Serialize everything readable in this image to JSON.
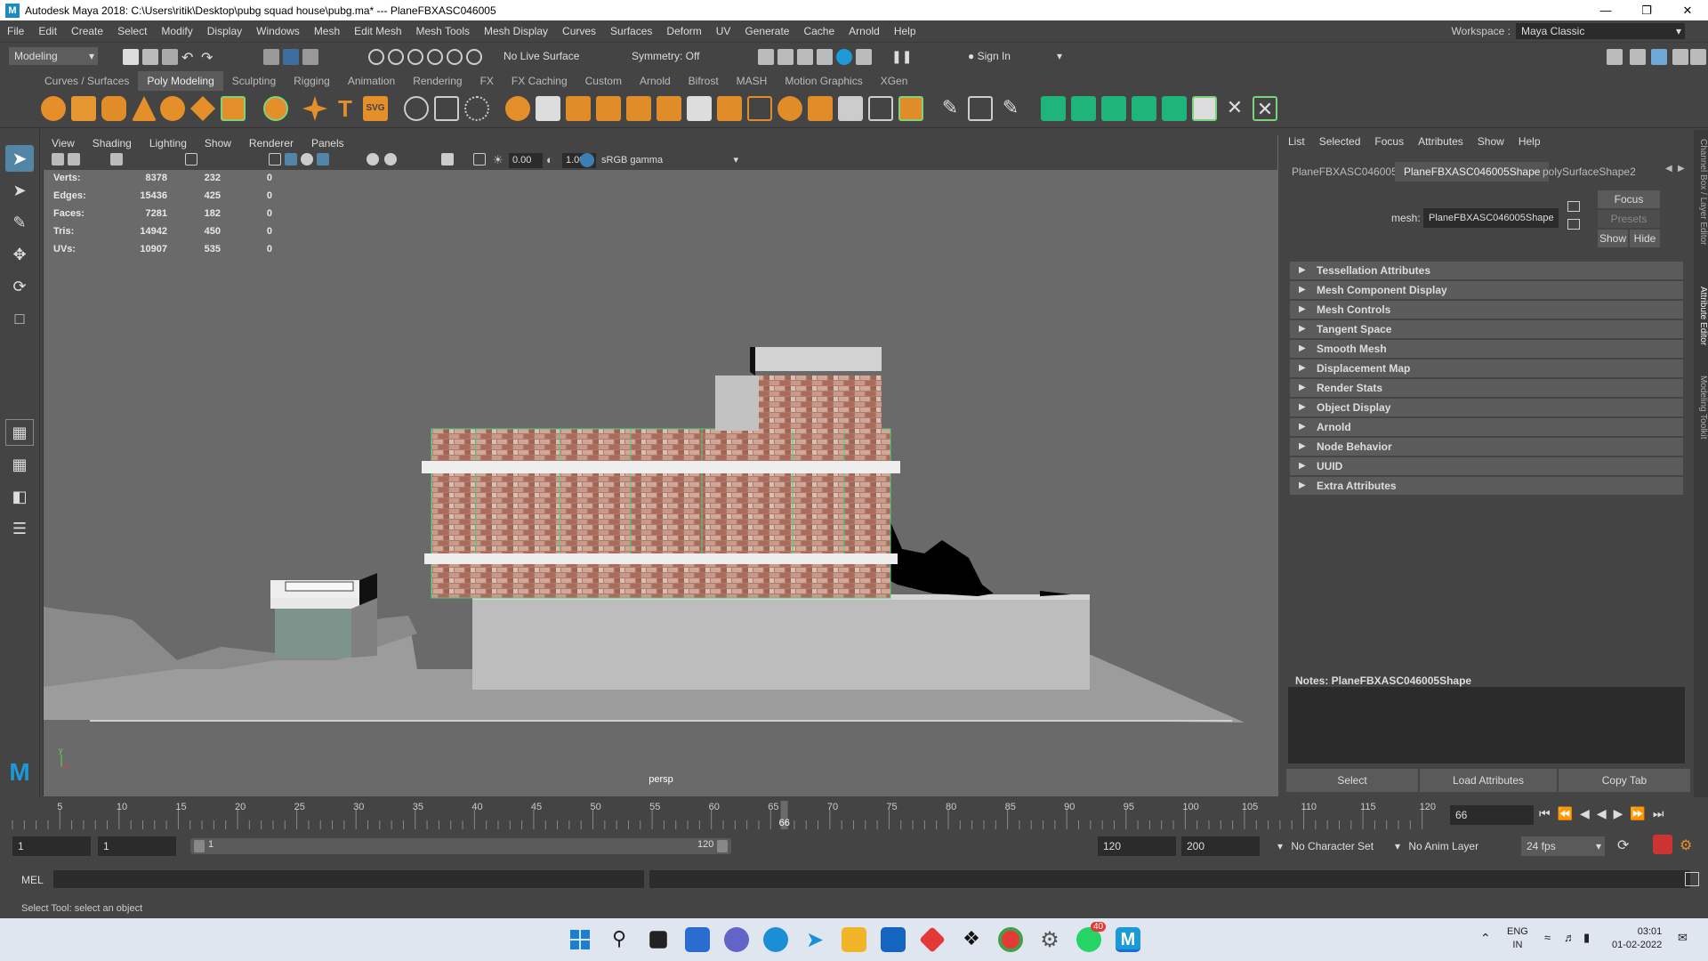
{
  "window": {
    "title": "Autodesk Maya 2018: C:\\Users\\ritik\\Desktop\\pubg squad house\\pubg.ma*  ---  PlaneFBXASC046005"
  },
  "menus": [
    "File",
    "Edit",
    "Create",
    "Select",
    "Modify",
    "Display",
    "Windows",
    "Mesh",
    "Edit Mesh",
    "Mesh Tools",
    "Mesh Display",
    "Curves",
    "Surfaces",
    "Deform",
    "UV",
    "Generate",
    "Cache",
    "Arnold",
    "Help"
  ],
  "workspace": {
    "label": "Workspace :",
    "value": "Maya Classic"
  },
  "statusline": {
    "mode": "Modeling",
    "live_surface": "No Live Surface",
    "symmetry": "Symmetry: Off",
    "sign_in": "Sign In"
  },
  "shelf_tabs": [
    "Curves / Surfaces",
    "Poly Modeling",
    "Sculpting",
    "Rigging",
    "Animation",
    "Rendering",
    "FX",
    "FX Caching",
    "Custom",
    "Arnold",
    "Bifrost",
    "MASH",
    "Motion Graphics",
    "XGen"
  ],
  "shelf_active": "Poly Modeling",
  "viewport": {
    "menus": [
      "View",
      "Shading",
      "Lighting",
      "Show",
      "Renderer",
      "Panels"
    ],
    "exposure": "0.00",
    "gamma": "1.00",
    "colorspace": "sRGB gamma",
    "camera": "persp",
    "hud": [
      {
        "label": "Verts:",
        "a": "8378",
        "b": "232",
        "c": "0"
      },
      {
        "label": "Edges:",
        "a": "15436",
        "b": "425",
        "c": "0"
      },
      {
        "label": "Faces:",
        "a": "7281",
        "b": "182",
        "c": "0"
      },
      {
        "label": "Tris:",
        "a": "14942",
        "b": "450",
        "c": "0"
      },
      {
        "label": "UVs:",
        "a": "10907",
        "b": "535",
        "c": "0"
      }
    ]
  },
  "attribute_editor": {
    "menus": [
      "List",
      "Selected",
      "Focus",
      "Attributes",
      "Show",
      "Help"
    ],
    "tabs": [
      "PlaneFBXASC046005",
      "PlaneFBXASC046005Shape",
      "polySurfaceShape2"
    ],
    "active_tab": "PlaneFBXASC046005Shape",
    "mesh_label": "mesh:",
    "mesh_value": "PlaneFBXASC046005Shape",
    "focus": "Focus",
    "presets": "Presets",
    "show": "Show",
    "hide": "Hide",
    "sections": [
      "Tessellation Attributes",
      "Mesh Component Display",
      "Mesh Controls",
      "Tangent Space",
      "Smooth Mesh",
      "Displacement Map",
      "Render Stats",
      "Object Display",
      "Arnold",
      "Node Behavior",
      "UUID",
      "Extra Attributes"
    ],
    "notes": "Notes:  PlaneFBXASC046005Shape",
    "buttons": [
      "Select",
      "Load Attributes",
      "Copy Tab"
    ]
  },
  "side_tabs": [
    "Channel Box / Layer Editor",
    "Attribute Editor",
    "Modeling Toolkit"
  ],
  "timeline": {
    "ticks": [
      "5",
      "10",
      "15",
      "20",
      "25",
      "30",
      "35",
      "40",
      "45",
      "50",
      "55",
      "60",
      "65",
      "70",
      "75",
      "80",
      "85",
      "90",
      "95",
      "100",
      "105",
      "110",
      "115",
      "120"
    ],
    "current": "66",
    "current_field": "66"
  },
  "range": {
    "start": "1",
    "start2": "1",
    "slider_start": "1",
    "slider_end": "120",
    "end": "120",
    "end2": "200",
    "char_set": "No Character Set",
    "anim_layer": "No Anim Layer",
    "fps": "24 fps"
  },
  "cmdline": {
    "label": "MEL"
  },
  "helpline": {
    "text": "Select Tool: select an object"
  },
  "taskbar": {
    "lang": "ENG",
    "lang2": "IN",
    "time": "03:01",
    "date": "01-02-2022",
    "badge": "40"
  }
}
